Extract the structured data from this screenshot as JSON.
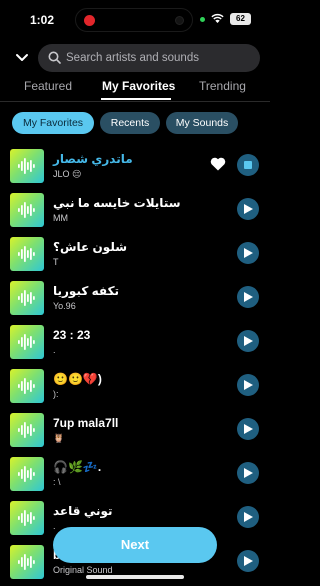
{
  "status": {
    "time": "1:02",
    "battery": "62"
  },
  "search": {
    "placeholder": "Search artists and sounds"
  },
  "tabs": [
    {
      "label": "Featured"
    },
    {
      "label": "My Favorites"
    },
    {
      "label": "Trending"
    }
  ],
  "filters": [
    {
      "label": "My Favorites"
    },
    {
      "label": "Recents"
    },
    {
      "label": "My Sounds"
    }
  ],
  "sounds": [
    {
      "title": "ماتدري شصار",
      "artist": "JLO 😔"
    },
    {
      "title": "ستايلات خايسه ما نبي",
      "artist": "MM"
    },
    {
      "title": "شلون عاش؟",
      "artist": "T"
    },
    {
      "title": "تكفه كبوريا",
      "artist": "Yo.96"
    },
    {
      "title": "23 : 23",
      "artist": "."
    },
    {
      "title": "🙂🙂💔)",
      "artist": "):"
    },
    {
      "title": "7up mala7ll",
      "artist": "🦉"
    },
    {
      "title": "🎧🌿💤.",
      "artist": ": \\"
    },
    {
      "title": "توني قاعد",
      "artist": "."
    },
    {
      "title": "b...",
      "artist": "Original Sound"
    }
  ],
  "next_button": {
    "label": "Next"
  },
  "colors": {
    "accent": "#5ac8f0",
    "play_bg": "#1f5f80",
    "chip_bg": "#2a4f63"
  }
}
